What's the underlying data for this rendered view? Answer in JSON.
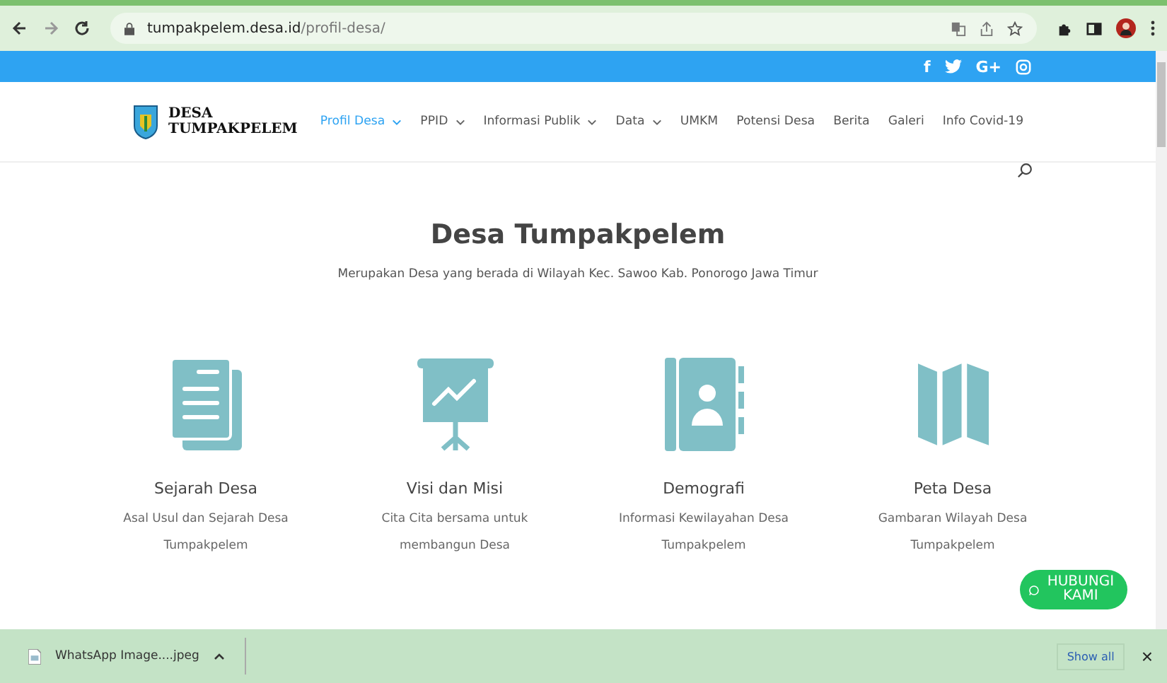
{
  "browser": {
    "url_domain": "tumpakpelem.desa.id",
    "url_path": "/profil-desa/"
  },
  "social": [
    {
      "kind": "text",
      "label": "f"
    },
    {
      "kind": "twitter"
    },
    {
      "kind": "text",
      "label": "G+"
    },
    {
      "kind": "instagram"
    }
  ],
  "logo": {
    "line1": "DESA",
    "line2": "TUMPAKPELEM"
  },
  "nav": [
    {
      "label": "Profil Desa",
      "dropdown": true,
      "selected": true
    },
    {
      "label": "PPID",
      "dropdown": true,
      "selected": false
    },
    {
      "label": "Informasi Publik",
      "dropdown": true,
      "selected": false
    },
    {
      "label": "Data",
      "dropdown": true,
      "selected": false
    },
    {
      "label": "UMKM",
      "dropdown": false,
      "selected": false
    },
    {
      "label": "Potensi Desa",
      "dropdown": false,
      "selected": false
    },
    {
      "label": "Berita",
      "dropdown": false,
      "selected": false
    },
    {
      "label": "Galeri",
      "dropdown": false,
      "selected": false
    },
    {
      "label": "Info Covid-19",
      "dropdown": false,
      "selected": false
    }
  ],
  "hero": {
    "title": "Desa Tumpakpelem",
    "subtitle": "Merupakan Desa yang berada di Wilayah Kec. Sawoo Kab. Ponorogo Jawa Timur"
  },
  "features": [
    {
      "kind": "document",
      "title": "Sejarah Desa",
      "text": "Asal Usul dan Sejarah Desa Tumpakpelem"
    },
    {
      "kind": "presentation",
      "title": "Visi dan Misi",
      "text": "Cita Cita bersama untuk membangun Desa"
    },
    {
      "kind": "contacts",
      "title": "Demografi",
      "text": "Informasi Kewilayahan Desa Tumpakpelem"
    },
    {
      "kind": "map",
      "title": "Peta Desa",
      "text": "Gambaran Wilayah Desa Tumpakpelem"
    }
  ],
  "contact_button": {
    "label": "HUBUNGI KAMI"
  },
  "downloads": {
    "file": "WhatsApp Image....jpeg",
    "show_all": "Show all",
    "close": "×"
  }
}
